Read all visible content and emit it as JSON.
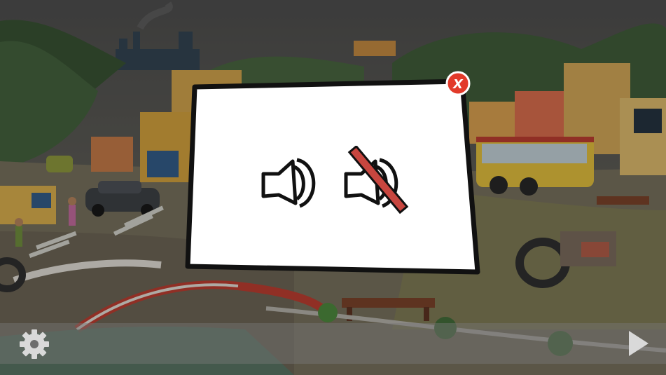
{
  "dialog": {
    "close_symbol": "X",
    "sound_on_icon": "speaker-on-icon",
    "sound_off_icon": "speaker-muted-icon"
  },
  "bottom_bar": {
    "settings_icon": "gear-icon",
    "next_icon": "play-arrow-icon"
  },
  "colors": {
    "close_button": "#e23a2a",
    "mute_strike": "#c8463f",
    "dialog_fill": "#ffffff",
    "dialog_border": "#111111"
  }
}
